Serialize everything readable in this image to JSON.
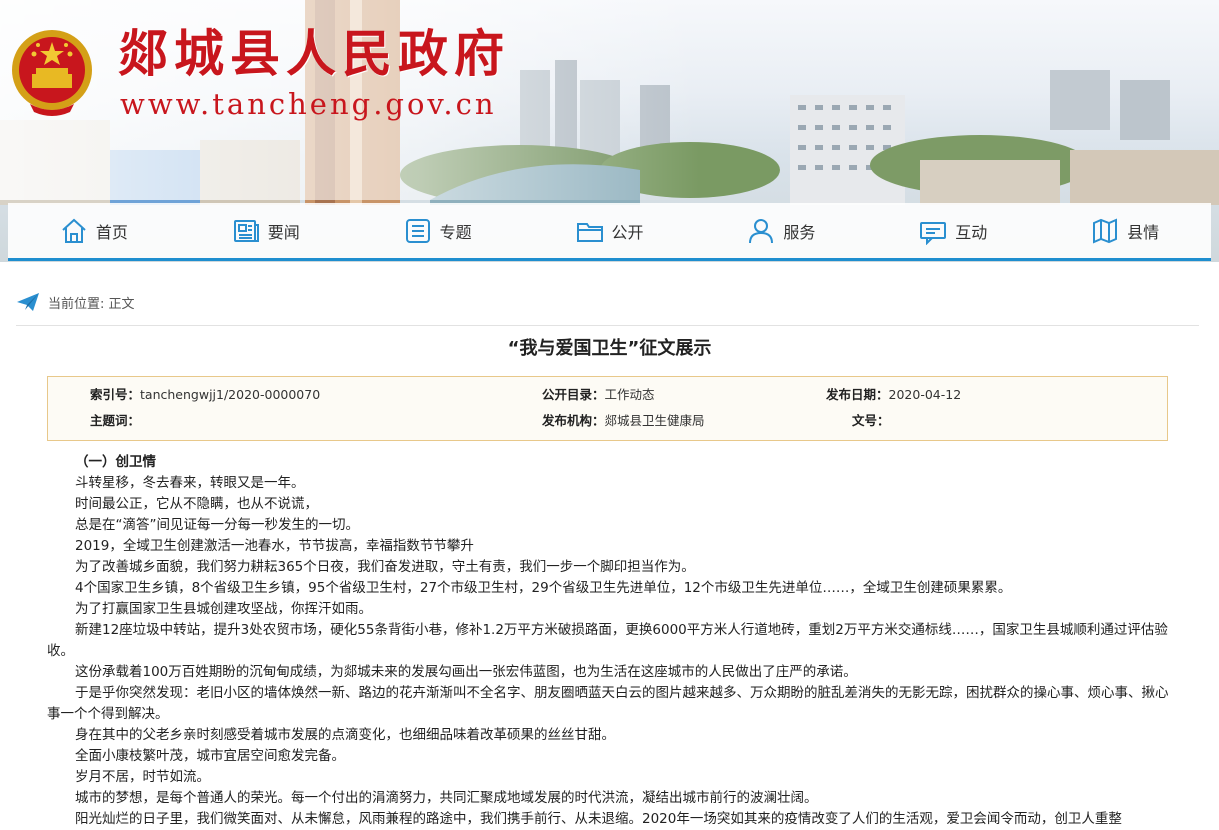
{
  "header": {
    "site_title": "郯城县人民政府",
    "site_url": "www.tancheng.gov.cn",
    "colors": {
      "brand_red": "#c8161d",
      "nav_accent": "#1e8ecf",
      "meta_border": "#e8c88a"
    }
  },
  "nav": {
    "items": [
      {
        "label": "首页",
        "icon": "home-icon"
      },
      {
        "label": "要闻",
        "icon": "news-icon"
      },
      {
        "label": "专题",
        "icon": "list-icon"
      },
      {
        "label": "公开",
        "icon": "folder-icon"
      },
      {
        "label": "服务",
        "icon": "person-icon"
      },
      {
        "label": "互动",
        "icon": "chat-icon"
      },
      {
        "label": "县情",
        "icon": "map-icon"
      }
    ]
  },
  "breadcrumb": {
    "text": "当前位置: 正文",
    "icon": "paper-plane-icon"
  },
  "article": {
    "title": "“我与爱国卫生”征文展示",
    "meta": {
      "index_label": "索引号：",
      "index_value": "tanchengwjj1/2020-0000070",
      "catalog_label": "公开目录：",
      "catalog_value": "工作动态",
      "date_label": "发布日期：",
      "date_value": "2020-04-12",
      "keywords_label": "主题词：",
      "keywords_value": "",
      "org_label": "发布机构：",
      "org_value": "郯城县卫生健康局",
      "docno_label": "文号：",
      "docno_value": ""
    },
    "subheading": "（一）创卫情",
    "paragraphs": [
      "斗转星移，冬去春来，转眼又是一年。",
      "时间最公正，它从不隐瞒，也从不说谎，",
      "总是在“滴答”间见证每一分每一秒发生的一切。",
      "2019，全域卫生创建激活一池春水，节节拔高，幸福指数节节攀升",
      "为了改善城乡面貌，我们努力耕耘365个日夜，我们奋发进取，守土有责，我们一步一个脚印担当作为。",
      "4个国家卫生乡镇，8个省级卫生乡镇，95个省级卫生村，27个市级卫生村，29个省级卫生先进单位，12个市级卫生先进单位……，全域卫生创建硕果累累。",
      "为了打赢国家卫生县城创建攻坚战，你挥汗如雨。",
      "新建12座垃圾中转站，提升3处农贸市场，硬化55条背街小巷，修补1.2万平方米破损路面，更换6000平方米人行道地砖，重划2万平方米交通标线……，国家卫生县城顺利通过评估验收。",
      "这份承载着100万百姓期盼的沉甸甸成绩，为郯城未来的发展勾画出一张宏伟蓝图，也为生活在这座城市的人民做出了庄严的承诺。",
      "于是乎你突然发现：老旧小区的墙体焕然一新、路边的花卉渐渐叫不全名字、朋友圈晒蓝天白云的图片越来越多、万众期盼的脏乱差消失的无影无踪，困扰群众的操心事、烦心事、揪心事一个个得到解决。",
      "身在其中的父老乡亲时刻感受着城市发展的点滴变化，也细细品味着改革硕果的丝丝甘甜。",
      "全面小康枝繁叶茂，城市宜居空间愈发完备。",
      "岁月不居，时节如流。",
      "城市的梦想，是每个普通人的荣光。每一个付出的涓滴努力，共同汇聚成地域发展的时代洪流，凝结出城市前行的波澜壮阔。",
      "阳光灿烂的日子里，我们微笑面对、从未懈怠，风雨兼程的路途中，我们携手前行、从未退缩。2020年一场突如其来的疫情改变了人们的生活观，爱卫会闻令而动，创卫人重整"
    ]
  }
}
